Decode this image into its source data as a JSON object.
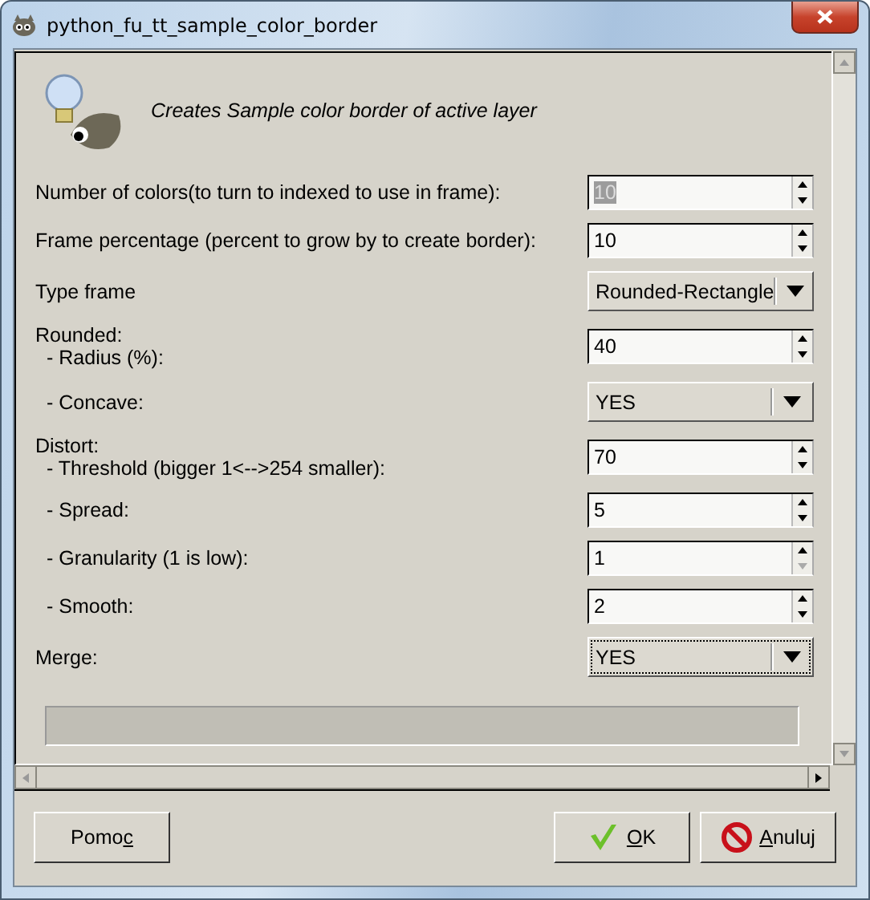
{
  "window": {
    "title": "python_fu_tt_sample_color_border"
  },
  "description": "Creates Sample color border of active layer",
  "fields": [
    {
      "kind": "spin",
      "label": "Number of colors(to turn to indexed to use in frame):",
      "value": "10",
      "text_selected": true,
      "down_disabled": false
    },
    {
      "kind": "spin",
      "label": "Frame percentage (percent to grow by to create border):",
      "value": "10",
      "text_selected": false,
      "down_disabled": false
    },
    {
      "kind": "combo",
      "label": "Type frame",
      "value": "Rounded-Rectangle",
      "focused": false
    },
    {
      "kind": "group",
      "label": "Rounded:",
      "children": [
        {
          "kind": "spin",
          "label": "- Radius (%):",
          "value": "40",
          "text_selected": false,
          "down_disabled": false
        },
        {
          "kind": "combo",
          "label": "- Concave:",
          "value": "YES",
          "focused": false
        }
      ]
    },
    {
      "kind": "group",
      "label": "Distort:",
      "children": [
        {
          "kind": "spin",
          "label": "- Threshold (bigger 1<-->254 smaller):",
          "value": "70",
          "text_selected": false,
          "down_disabled": false
        },
        {
          "kind": "spin",
          "label": "- Spread:",
          "value": "5",
          "text_selected": false,
          "down_disabled": false
        },
        {
          "kind": "spin",
          "label": "- Granularity (1 is low):",
          "value": "1",
          "text_selected": false,
          "down_disabled": true
        },
        {
          "kind": "spin",
          "label": "- Smooth:",
          "value": "2",
          "text_selected": false,
          "down_disabled": false
        }
      ]
    },
    {
      "kind": "combo",
      "label": "Merge:",
      "value": "YES",
      "focused": true
    }
  ],
  "buttons": [
    {
      "kind": "help",
      "before": "Pomo",
      "key": "c"
    },
    {
      "kind": "ok",
      "key": "O",
      "after": "K"
    },
    {
      "kind": "cancel",
      "key": "A",
      "after": "nuluj"
    }
  ]
}
